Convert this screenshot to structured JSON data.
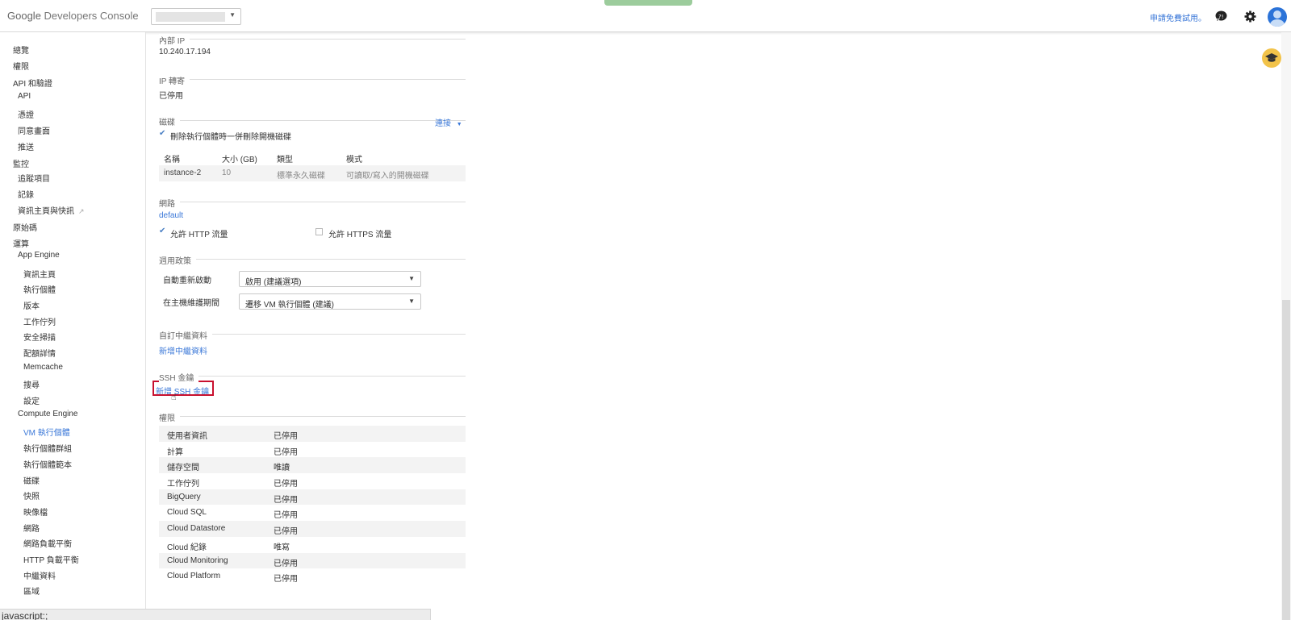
{
  "header": {
    "logo_google": "Google",
    "logo_product": "Developers Console",
    "trial_link": "申請免費試用。"
  },
  "sidebar": {
    "items": [
      {
        "label": "總覽"
      },
      {
        "label": "權限"
      },
      {
        "label": "API 和驗證"
      },
      {
        "label": "API"
      },
      {
        "label": "憑證"
      },
      {
        "label": "同意畫面"
      },
      {
        "label": "推送"
      },
      {
        "label": "監控"
      },
      {
        "label": "追蹤項目"
      },
      {
        "label": "記錄"
      },
      {
        "label": "資訊主頁與快訊"
      },
      {
        "label": "原始碼"
      },
      {
        "label": "運算"
      },
      {
        "label": "App Engine"
      },
      {
        "label": "資訊主頁"
      },
      {
        "label": "執行個體"
      },
      {
        "label": "版本"
      },
      {
        "label": "工作佇列"
      },
      {
        "label": "安全掃描"
      },
      {
        "label": "配額詳情"
      },
      {
        "label": "Memcache"
      },
      {
        "label": "搜尋"
      },
      {
        "label": "設定"
      },
      {
        "label": "Compute Engine"
      },
      {
        "label": "VM 執行個體"
      },
      {
        "label": "執行個體群組"
      },
      {
        "label": "執行個體範本"
      },
      {
        "label": "磁碟"
      },
      {
        "label": "快照"
      },
      {
        "label": "映像檔"
      },
      {
        "label": "網路"
      },
      {
        "label": "網路負載平衡"
      },
      {
        "label": "HTTP 負載平衡"
      },
      {
        "label": "中繼資料"
      },
      {
        "label": "區域"
      }
    ]
  },
  "main": {
    "internal_ip": {
      "label": "內部 IP",
      "value": "10.240.17.194"
    },
    "ip_forwarding": {
      "label": "IP 轉寄",
      "value": "已停用"
    },
    "disks": {
      "label": "磁碟",
      "attach_link": "連接",
      "delete_checkbox_label": "刪除執行個體時一併刪除開機磁碟",
      "columns": [
        "名稱",
        "大小 (GB)",
        "類型",
        "模式"
      ],
      "rows": [
        {
          "name": "instance-2",
          "size": "10",
          "type": "標準永久磁碟",
          "mode": "可讀取/寫入的開機磁碟"
        }
      ]
    },
    "network": {
      "label": "網路",
      "value": "default",
      "http_label": "允許 HTTP 流量",
      "http_checked": true,
      "https_label": "允許 HTTPS 流量",
      "https_checked": false
    },
    "policy": {
      "label": "週用政策",
      "auto_restart_label": "自動重新啟動",
      "auto_restart_value": "啟用 (建議選項)",
      "maintenance_label": "在主機維護期間",
      "maintenance_value": "遷移 VM 執行個體 (建議)"
    },
    "custom_metadata": {
      "label": "自訂中繼資料",
      "add_link": "新增中繼資料"
    },
    "ssh_keys": {
      "label": "SSH 金鑰",
      "add_link": "新增 SSH 金鑰"
    },
    "permissions": {
      "label": "權限",
      "rows": [
        {
          "key": "使用者資訊",
          "value": "已停用"
        },
        {
          "key": "計算",
          "value": "已停用"
        },
        {
          "key": "儲存空間",
          "value": "唯讀"
        },
        {
          "key": "工作佇列",
          "value": "已停用"
        },
        {
          "key": "BigQuery",
          "value": "已停用"
        },
        {
          "key": "Cloud SQL",
          "value": "已停用"
        },
        {
          "key": "Cloud Datastore",
          "value": "已停用"
        },
        {
          "key": "Cloud 紀錄",
          "value": "唯寫"
        },
        {
          "key": "Cloud Monitoring",
          "value": "已停用"
        },
        {
          "key": "Cloud Platform",
          "value": "已停用"
        }
      ]
    }
  },
  "status_bar": "javascript:;",
  "colors": {
    "accent": "#3b78d8",
    "highlight_box": "#c8102e",
    "hat_badge": "#f2c34a"
  }
}
